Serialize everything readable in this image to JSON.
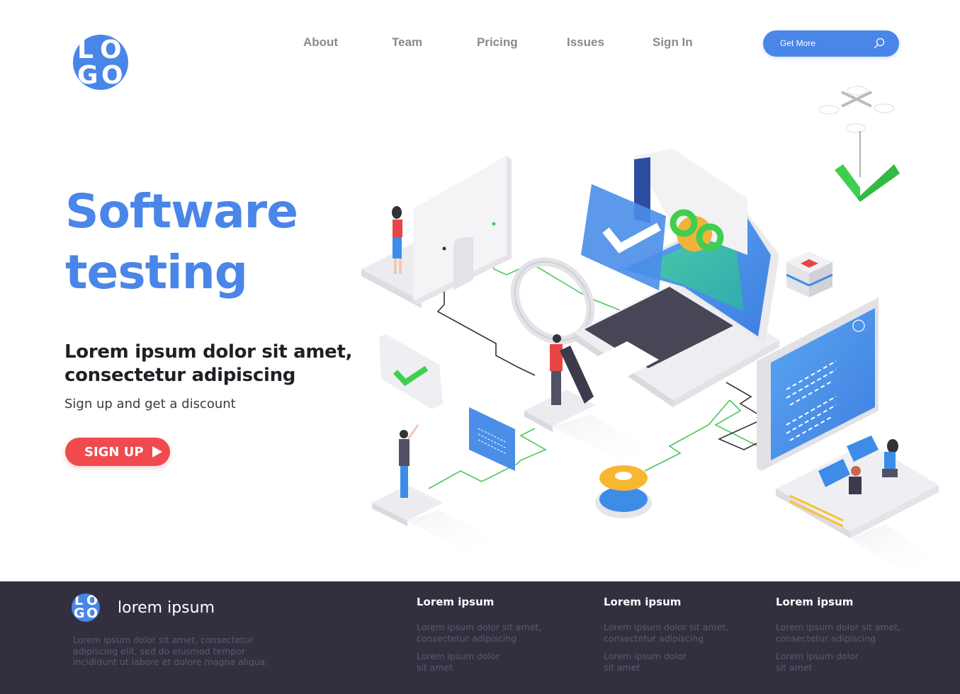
{
  "brand": {
    "logo_letters": [
      "L",
      "O",
      "G",
      "O"
    ],
    "accent_color": "#4a86e8",
    "cta_color": "#f04a4e",
    "footer_bg": "#32303f"
  },
  "nav": {
    "items": [
      {
        "label": "About"
      },
      {
        "label": "Team"
      },
      {
        "label": "Pricing"
      },
      {
        "label": "Issues"
      },
      {
        "label": "Sign In"
      }
    ]
  },
  "search": {
    "label": "Get More",
    "icon": "search-icon"
  },
  "hero": {
    "title_line1": "Software",
    "title_line2": "testing",
    "subtitle_line1": "Lorem ipsum dolor sit amet,",
    "subtitle_line2": "consectetur adipiscing",
    "tagline": "Sign up and get a discount",
    "cta_label": "SIGN UP",
    "cta_icon": "play-icon"
  },
  "illustration": {
    "description": "Isometric software testing scene: monitor, laptop with checkmark window and infinity/gear, magnifying glass, people, drone carrying green checkmark, server stack, gear, code panels, team working at desk"
  },
  "footer": {
    "brand_name": "lorem ipsum",
    "description": "Lorem ipsum dolor sit amet, consectetur adipiscing elit, sed do eiusmod tempor incididunt ut labore et dolore magna aliqua.",
    "columns": [
      {
        "heading": "Lorem ipsum",
        "line1": "Lorem ipsum dolor sit amet, consectetur adipiscing",
        "line2": "Lorem ipsum dolor sit amet"
      },
      {
        "heading": "Lorem ipsum",
        "line1": "Lorem ipsum dolor sit amet, consectetur adipiscing",
        "line2": "Lorem ipsum dolor sit amet"
      },
      {
        "heading": "Lorem ipsum",
        "line1": "Lorem ipsum dolor sit amet, consectetur adipiscing",
        "line2": "Lorem ipsum dolor sit amet"
      }
    ]
  }
}
